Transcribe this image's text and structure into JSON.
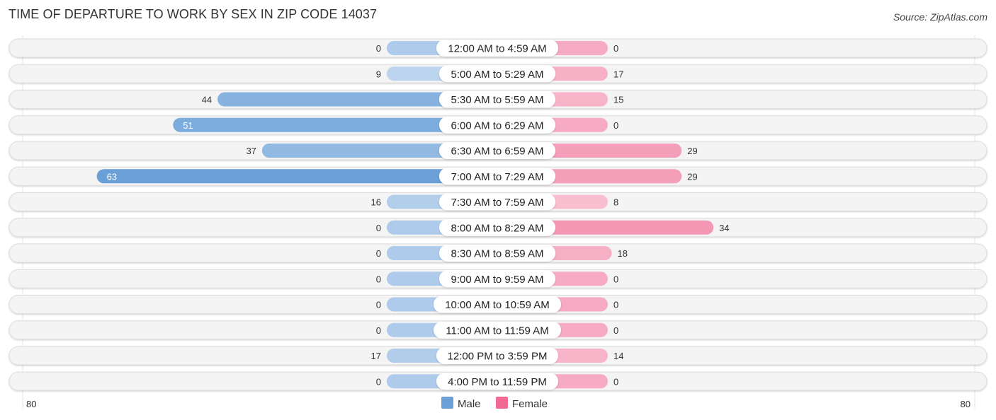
{
  "header": {
    "title": "TIME OF DEPARTURE TO WORK BY SEX IN ZIP CODE 14037",
    "source": "Source: ZipAtlas.com"
  },
  "chart_data": {
    "type": "bar",
    "orientation": "horizontal-diverging",
    "title": "TIME OF DEPARTURE TO WORK BY SEX IN ZIP CODE 14037",
    "categories": [
      "12:00 AM to 4:59 AM",
      "5:00 AM to 5:29 AM",
      "5:30 AM to 5:59 AM",
      "6:00 AM to 6:29 AM",
      "6:30 AM to 6:59 AM",
      "7:00 AM to 7:29 AM",
      "7:30 AM to 7:59 AM",
      "8:00 AM to 8:29 AM",
      "8:30 AM to 8:59 AM",
      "9:00 AM to 9:59 AM",
      "10:00 AM to 10:59 AM",
      "11:00 AM to 11:59 AM",
      "12:00 PM to 3:59 PM",
      "4:00 PM to 11:59 PM"
    ],
    "series": [
      {
        "name": "Male",
        "color": "#6a9fd8",
        "values": [
          0,
          9,
          44,
          51,
          37,
          63,
          16,
          0,
          0,
          0,
          0,
          0,
          17,
          0
        ]
      },
      {
        "name": "Female",
        "color": "#f06a94",
        "values": [
          0,
          17,
          15,
          0,
          29,
          29,
          8,
          34,
          18,
          0,
          0,
          0,
          14,
          0
        ]
      }
    ],
    "axis": {
      "left_label": "80",
      "right_label": "80",
      "max": 80
    },
    "legend": {
      "position": "bottom-center",
      "items": [
        "Male",
        "Female"
      ]
    }
  }
}
